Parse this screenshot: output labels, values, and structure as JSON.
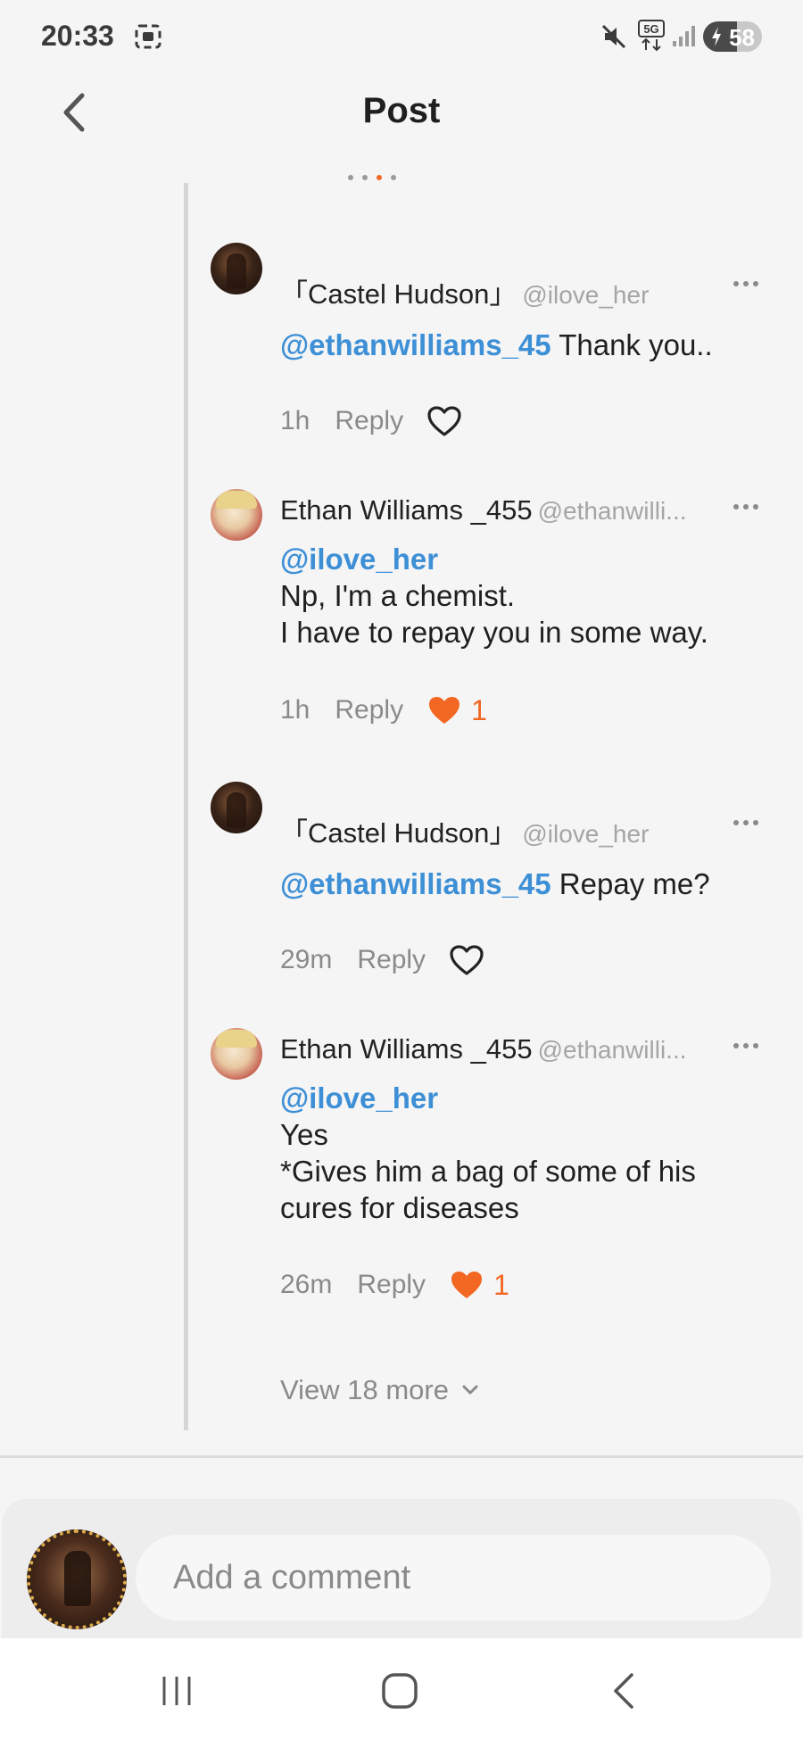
{
  "status_bar": {
    "time": "20:33",
    "network": "5G",
    "battery": "58"
  },
  "header": {
    "title": "Post"
  },
  "comments": [
    {
      "name": "「Castel Hudson」",
      "handle": "@ilove_her",
      "mention": "@ethanwilliams_45",
      "text": " Thank you..",
      "time": "1h",
      "reply": "Reply",
      "liked": false,
      "like_count": ""
    },
    {
      "name": "Ethan Williams _455",
      "handle": "@ethanwilli...",
      "mention": "@ilove_her",
      "lines": [
        "Np, I'm a chemist.",
        "I have to repay you in some way."
      ],
      "time": "1h",
      "reply": "Reply",
      "liked": true,
      "like_count": "1"
    },
    {
      "name": "「Castel Hudson」",
      "handle": "@ilove_her",
      "mention": "@ethanwilliams_45",
      "text": " Repay me?",
      "time": "29m",
      "reply": "Reply",
      "liked": false,
      "like_count": ""
    },
    {
      "name": "Ethan Williams _455",
      "handle": "@ethanwilli...",
      "mention": "@ilove_her",
      "lines": [
        "Yes",
        "*Gives him a bag of some of his",
        "cures for diseases"
      ],
      "time": "26m",
      "reply": "Reply",
      "liked": true,
      "like_count": "1"
    }
  ],
  "view_more": "View 18 more",
  "comment_bar": {
    "placeholder": "Add a comment"
  },
  "colors": {
    "mention": "#3d8fd6",
    "like": "#f26722",
    "background": "#f5f5f5"
  },
  "icons": {
    "back": "chevron-left-icon",
    "like": "heart-icon",
    "more": "more-dots-icon",
    "view_more": "chevron-down-icon",
    "nav": [
      "recent-apps-icon",
      "home-icon",
      "back-icon"
    ]
  }
}
